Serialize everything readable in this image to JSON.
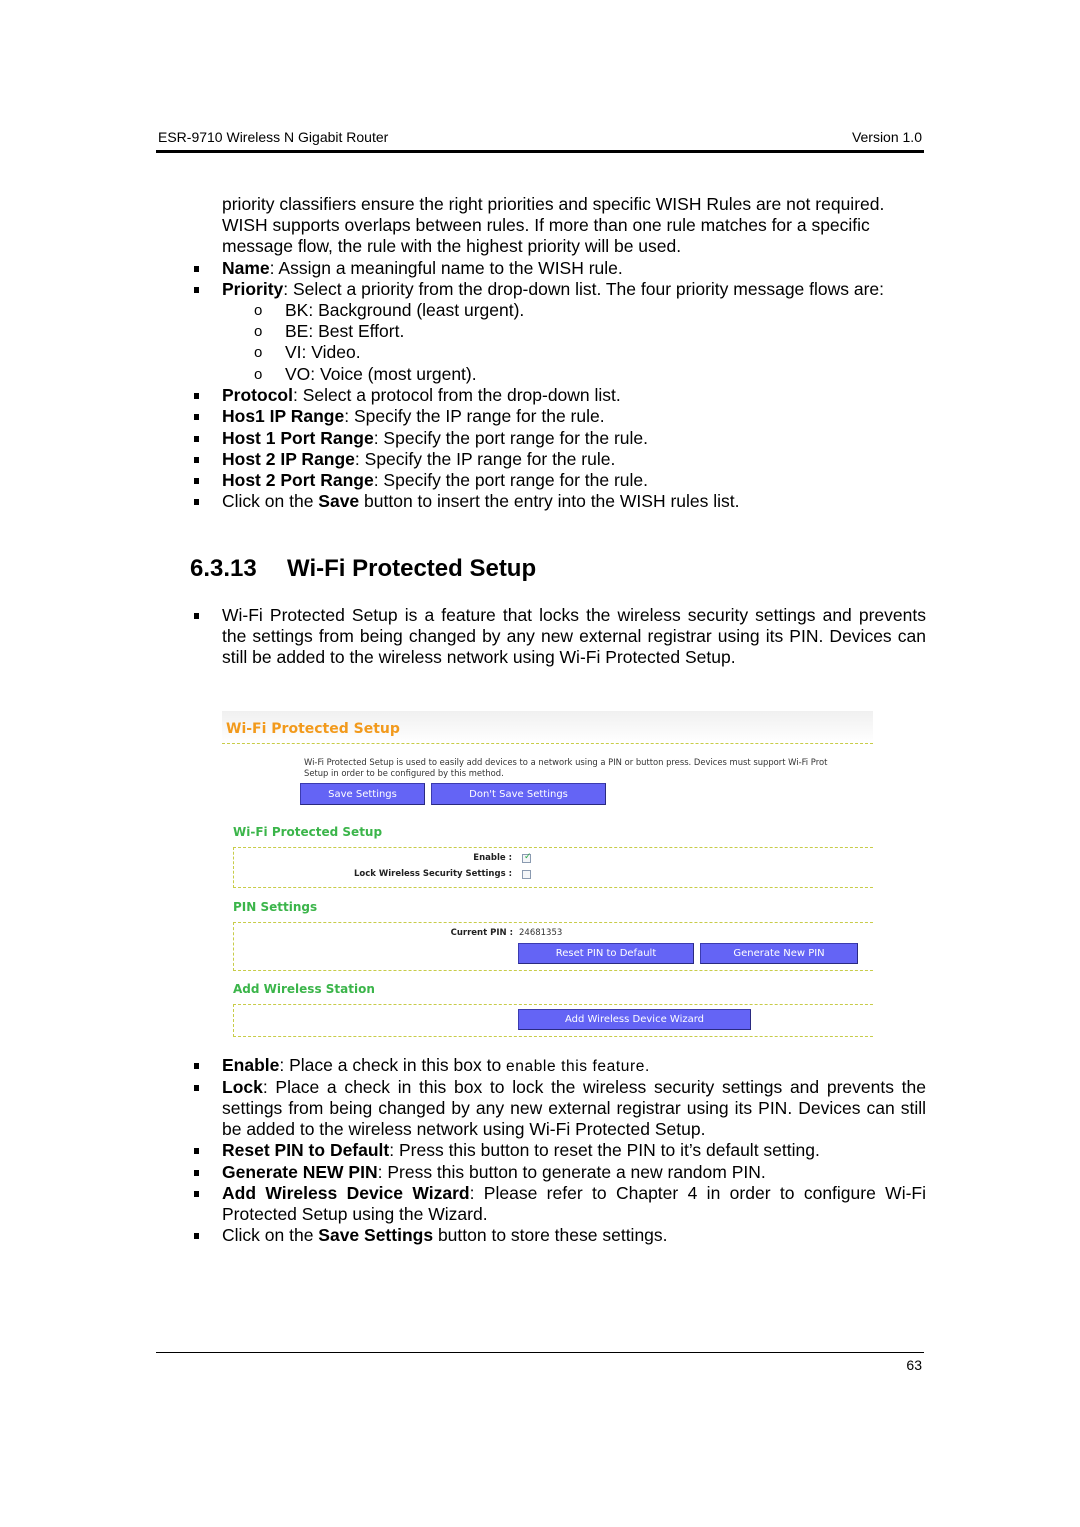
{
  "header": {
    "doc_title": "ESR-9710 Wireless N Gigabit Router",
    "version": "Version 1.0"
  },
  "intro": {
    "continuation_lines": [
      "priority classifiers ensure the right priorities and specific WISH Rules are not required.",
      "WISH supports overlaps between rules. If more than one rule matches for a specific",
      "message flow, the rule with the highest priority will be used."
    ],
    "bullets": [
      {
        "term": "Name",
        "text": ": Assign a meaningful name to the WISH rule."
      },
      {
        "term": "Priority",
        "text": ": Select a priority from the drop-down list. The four priority message flows are:"
      }
    ],
    "priority_flows": [
      "BK: Background (least urgent).",
      "BE: Best Effort.",
      "VI: Video.",
      "VO: Voice (most urgent)."
    ],
    "bullets2": [
      {
        "term": "Protocol",
        "text": ": Select a protocol from the drop-down list."
      },
      {
        "term": "Hos1 IP Range",
        "text": ": Specify the IP range for the rule."
      },
      {
        "term": "Host 1 Port Range",
        "text": ": Specify the port range for the rule."
      },
      {
        "term": "Host 2 IP Range",
        "text": ": Specify the IP range for the rule."
      },
      {
        "term": "Host 2 Port Range",
        "text": ": Specify the port range for the rule."
      }
    ],
    "save_line": {
      "pre": "Click on the ",
      "term": "Save",
      "post": " button to insert the entry into the WISH rules list."
    }
  },
  "section": {
    "number": "6.3.13",
    "title": "Wi-Fi Protected Setup",
    "description": "Wi-Fi Protected Setup is a feature that locks the wireless security settings and prevents the settings from being changed by any new external registrar using its PIN. Devices can still be added to the wireless network using Wi-Fi Protected Setup."
  },
  "router_ui": {
    "page_title": "Wi-Fi Protected Setup",
    "description_line1": "Wi-Fi Protected Setup is used to easily add devices to a network using a PIN or button press. Devices must support Wi-Fi Prot",
    "description_line2": "Setup in order to be configured by this method.",
    "save_button": "Save Settings",
    "dont_save_button": "Don't Save Settings",
    "wps_section": {
      "title": "Wi-Fi Protected Setup",
      "enable_label": "Enable :",
      "enable_checked": true,
      "lock_label": "Lock Wireless Security Settings :",
      "lock_checked": false
    },
    "pin_section": {
      "title": "PIN Settings",
      "current_pin_label": "Current PIN :",
      "current_pin": "24681353",
      "reset_button": "Reset PIN to Default",
      "generate_button": "Generate New PIN"
    },
    "station_section": {
      "title": "Add Wireless Station",
      "wizard_button": "Add Wireless Device Wizard"
    },
    "colors": {
      "title_orange": "#f29a1c",
      "section_green": "#3bb54a",
      "button_blue": "#6464f5",
      "dash_line": "#c8cc48"
    }
  },
  "explain": {
    "enable": {
      "term": "Enable",
      "text": ": Place a check in this box to ",
      "tail": "enable this feature."
    },
    "lock": {
      "term": "Lock",
      "text": ": Place a check in this box to lock the wireless security settings and prevents the settings from being changed by any new external registrar using its PIN. Devices can still be added to the wireless network using Wi-Fi Protected Setup."
    },
    "reset": {
      "term": "Reset PIN to Default",
      "text": ": Press this button to reset the PIN to it’s default setting."
    },
    "generate": {
      "term": "Generate NEW PIN",
      "text": ": Press this button to generate a new random PIN."
    },
    "wizard": {
      "term": "Add Wireless Device Wizard",
      "text": ": Please refer to Chapter 4 in order to configure Wi-Fi Protected Setup using the Wizard."
    },
    "save": {
      "pre": "Click on the ",
      "term": "Save Settings",
      "post": " button to store these settings."
    }
  },
  "footer": {
    "page_number": "63"
  }
}
